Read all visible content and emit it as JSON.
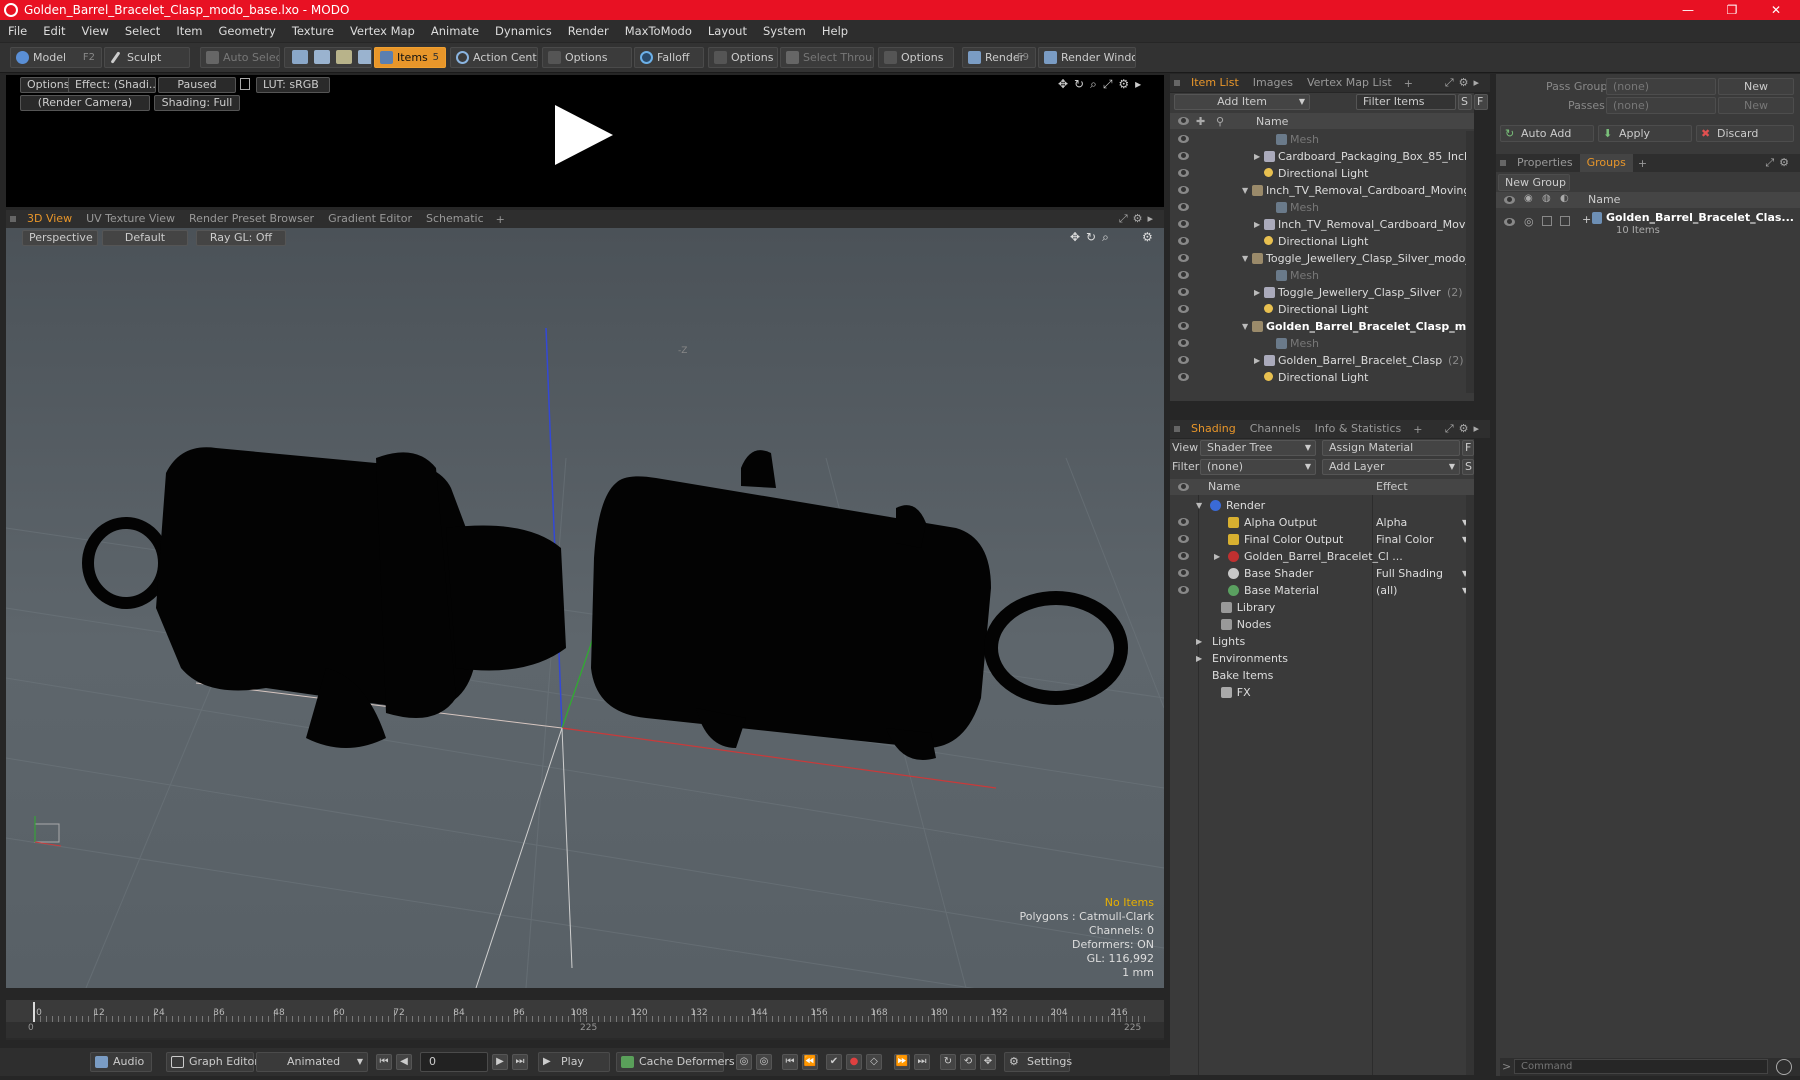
{
  "window": {
    "title": "Golden_Barrel_Bracelet_Clasp_modo_base.lxo - MODO",
    "minimize": "—",
    "maximize": "❐",
    "close": "✕"
  },
  "menu": [
    "File",
    "Edit",
    "View",
    "Select",
    "Item",
    "Geometry",
    "Texture",
    "Vertex Map",
    "Animate",
    "Dynamics",
    "Render",
    "MaxToModo",
    "Layout",
    "System",
    "Help"
  ],
  "toolbar": {
    "model": "Model",
    "model_key": "F2",
    "sculpt": "Sculpt",
    "auto_select": "Auto Select",
    "items": "Items",
    "items_key": "5",
    "action_center": "Action Center",
    "options1": "Options",
    "falloff": "Falloff",
    "options2": "Options",
    "select_through": "Select Through",
    "options3": "Options",
    "render": "Render",
    "render_key": "F9",
    "render_window": "Render Window"
  },
  "preview": {
    "options": "Options",
    "effect": "Effect: (Shadi...",
    "paused": "Paused",
    "lut": "LUT: sRGB",
    "camera": "(Render Camera)",
    "shading": "Shading: Full"
  },
  "viewtabs": [
    "3D View",
    "UV Texture View",
    "Render Preset Browser",
    "Gradient Editor",
    "Schematic"
  ],
  "viewport": {
    "perspective": "Perspective",
    "default": "Default",
    "raygl": "Ray GL: Off",
    "axis_label": "-Z",
    "info": {
      "no_items": "No Items",
      "polygons": "Polygons : Catmull-Clark",
      "channels": "Channels: 0",
      "deformers": "Deformers: ON",
      "gl": "GL: 116,992",
      "unit": "1 mm"
    }
  },
  "timeline": {
    "ticks": [
      "0",
      "12",
      "24",
      "36",
      "48",
      "60",
      "72",
      "84",
      "96",
      "108",
      "120",
      "132",
      "144",
      "156",
      "168",
      "180",
      "192",
      "204",
      "216"
    ],
    "start": "0",
    "mid": "225",
    "end": "225"
  },
  "bottombar": {
    "audio": "Audio",
    "graph_editor": "Graph Editor",
    "animated": "Animated",
    "frame": "0",
    "play": "Play",
    "cache_deformers": "Cache Deformers",
    "settings": "Settings"
  },
  "itemlist": {
    "tabs": [
      "Item List",
      "Images",
      "Vertex Map List"
    ],
    "add_item": "Add Item",
    "filter_items": "Filter Items",
    "s": "S",
    "f": "F",
    "col_name": "Name",
    "rows": [
      {
        "label": "Mesh",
        "indent": 3,
        "kind": "mesh",
        "dim": true,
        "arrow": ""
      },
      {
        "label": "Cardboard_Packaging_Box_85_Inch_...",
        "indent": 2,
        "kind": "group",
        "arrow": "▶"
      },
      {
        "label": "Directional Light",
        "indent": 2,
        "kind": "light",
        "arrow": ""
      },
      {
        "label": "Inch_TV_Removal_Cardboard_Moving_B...",
        "indent": 1,
        "kind": "scene",
        "arrow": "▼"
      },
      {
        "label": "Mesh",
        "indent": 3,
        "kind": "mesh",
        "dim": true,
        "arrow": ""
      },
      {
        "label": "Inch_TV_Removal_Cardboard_Moving...",
        "indent": 2,
        "kind": "group",
        "arrow": "▶"
      },
      {
        "label": "Directional Light",
        "indent": 2,
        "kind": "light",
        "arrow": ""
      },
      {
        "label": "Toggle_Jewellery_Clasp_Silver_modo_b ...",
        "indent": 1,
        "kind": "scene",
        "arrow": "▼"
      },
      {
        "label": "Mesh",
        "indent": 3,
        "kind": "mesh",
        "dim": true,
        "arrow": ""
      },
      {
        "label": "Toggle_Jewellery_Clasp_Silver",
        "count": "(2)",
        "indent": 2,
        "kind": "group",
        "arrow": "▶"
      },
      {
        "label": "Directional Light",
        "indent": 2,
        "kind": "light",
        "arrow": ""
      },
      {
        "label": "Golden_Barrel_Bracelet_Clasp_m ...",
        "indent": 1,
        "kind": "scene",
        "bold": true,
        "arrow": "▼"
      },
      {
        "label": "Mesh",
        "indent": 3,
        "kind": "mesh",
        "dim": true,
        "arrow": ""
      },
      {
        "label": "Golden_Barrel_Bracelet_Clasp",
        "count": "(2)",
        "indent": 2,
        "kind": "group",
        "arrow": "▶"
      },
      {
        "label": "Directional Light",
        "indent": 2,
        "kind": "light",
        "arrow": ""
      }
    ]
  },
  "shading": {
    "tabs": [
      "Shading",
      "Channels",
      "Info & Statistics"
    ],
    "view_label": "View",
    "view_value": "Shader Tree",
    "assign_material": "Assign Material",
    "filter_label": "Filter",
    "filter_value": "(none)",
    "add_layer": "Add Layer",
    "f": "F",
    "s": "S",
    "col_name": "Name",
    "col_effect": "Effect",
    "rows": [
      {
        "label": "Render",
        "effect": "",
        "indent": 0,
        "arrow": "▼",
        "icon": "render",
        "eye": false
      },
      {
        "label": "Alpha Output",
        "effect": "Alpha",
        "indent": 1,
        "arrow": "",
        "icon": "output",
        "eye": true
      },
      {
        "label": "Final Color Output",
        "effect": "Final Color",
        "indent": 1,
        "arrow": "",
        "icon": "output",
        "eye": true
      },
      {
        "label": "Golden_Barrel_Bracelet_Cl ...",
        "effect": "",
        "indent": 1,
        "arrow": "▶",
        "icon": "material",
        "eye": true
      },
      {
        "label": "Base Shader",
        "effect": "Full Shading",
        "indent": 1,
        "arrow": "",
        "icon": "shader",
        "eye": true
      },
      {
        "label": "Base Material",
        "effect": "(all)",
        "indent": 1,
        "arrow": "",
        "icon": "basemat",
        "eye": true
      },
      {
        "label": "Library",
        "effect": "",
        "indent": 0.6,
        "arrow": "",
        "icon": "folder",
        "eye": false
      },
      {
        "label": "Nodes",
        "effect": "",
        "indent": 0.6,
        "arrow": "",
        "icon": "folder",
        "eye": false
      },
      {
        "label": "Lights",
        "effect": "",
        "indent": 0,
        "arrow": "▶",
        "icon": "",
        "eye": false
      },
      {
        "label": "Environments",
        "effect": "",
        "indent": 0,
        "arrow": "▶",
        "icon": "",
        "eye": false
      },
      {
        "label": "Bake Items",
        "effect": "",
        "indent": 0,
        "arrow": "",
        "icon": "",
        "eye": false
      },
      {
        "label": "FX",
        "effect": "",
        "indent": 0.6,
        "arrow": "",
        "icon": "fx",
        "eye": false
      }
    ]
  },
  "rightpanel": {
    "pass_groups": "Pass Groups",
    "pass_groups_value": "(none)",
    "new": "New",
    "passes": "Passes",
    "passes_value": "(none)",
    "new2": "New",
    "auto_add": "Auto Add",
    "apply": "Apply",
    "discard": "Discard",
    "tabs": [
      "Properties",
      "Groups"
    ],
    "new_group": "New Group",
    "col_name": "Name",
    "group_name": "Golden_Barrel_Bracelet_Clas...",
    "group_count": "10 Items",
    "command_placeholder": "Command"
  },
  "colors": {
    "accent": "#e8962a",
    "title": "#e81123"
  }
}
